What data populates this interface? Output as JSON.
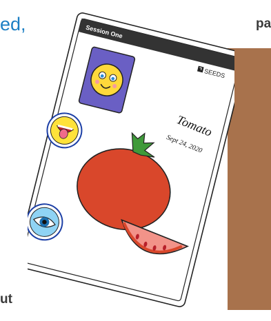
{
  "fragments": {
    "top_left": "ed,",
    "top_right": "pa",
    "bottom_left": "ut"
  },
  "card": {
    "header": "Session One",
    "brand": "SEEDS",
    "title": "Tomato",
    "date": "Sept 24, 2020"
  },
  "icons": [
    "smiley-card-icon",
    "tongue-out-face-icon",
    "eye-icon",
    "tomato-icon",
    "tomato-slice-icon",
    "seeds-logo-icon"
  ],
  "colors": {
    "accent_blue": "#1c7fc4",
    "card_header": "#333333",
    "tomato": "#d9472b",
    "leaf": "#3f9a3a",
    "brown_panel": "#a8724c"
  }
}
